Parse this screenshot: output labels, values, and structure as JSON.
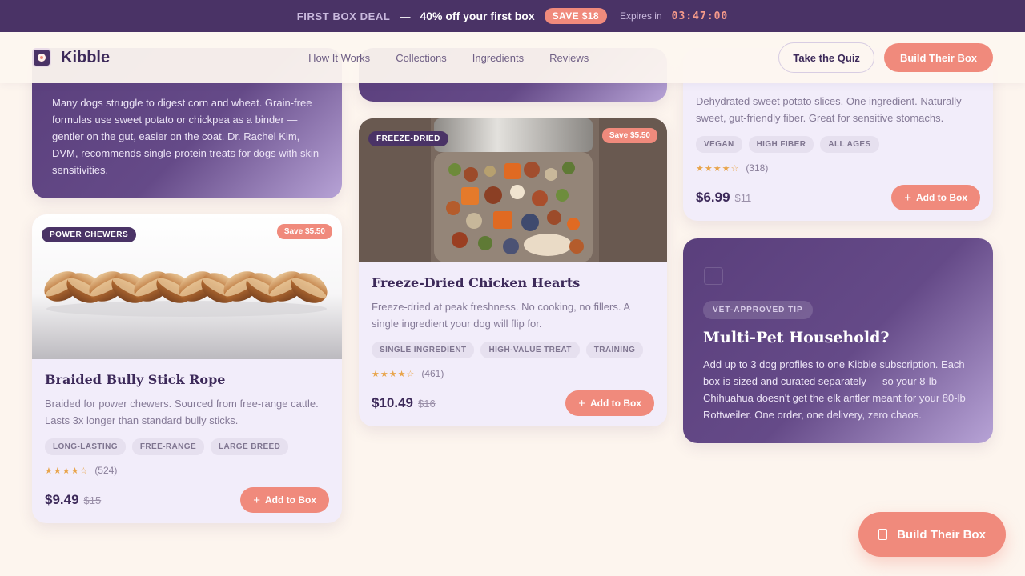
{
  "promo": {
    "deal_label": "FIRST BOX DEAL",
    "separator": "—",
    "offer": "40% off your first box",
    "save_badge": "SAVE $18",
    "expires_label": "Expires in",
    "timer": "03:47:00"
  },
  "header": {
    "logo_text": "Kibble",
    "nav": [
      "How It Works",
      "Collections",
      "Ingredients",
      "Reviews"
    ],
    "quiz_button": "Take the Quiz",
    "build_button": "Build Their Box"
  },
  "tip_card_top": {
    "text": "Many dogs struggle to digest corn and wheat. Grain-free formulas use sweet potato or chickpea as a binder — gentler on the gut, easier on the coat. Dr. Rachel Kim, DVM, recommends single-protein treats for dogs with skin sensitivities."
  },
  "products": [
    {
      "badge": "POWER CHEWERS",
      "save": "Save $5.50",
      "title": "Braided Bully Stick Rope",
      "desc": "Braided for power chewers. Sourced from free-range cattle. Lasts 3x longer than standard bully sticks.",
      "tags": [
        "LONG-LASTING",
        "FREE-RANGE",
        "LARGE BREED"
      ],
      "stars": "★★★★☆",
      "rating": 4,
      "reviews": "(524)",
      "price": "$9.49",
      "old_price": "$15",
      "add_label": "Add to Box"
    },
    {
      "badge": "FREEZE-DRIED",
      "save": "Save $5.50",
      "title": "Freeze-Dried Chicken Hearts",
      "desc": "Freeze-dried at peak freshness. No cooking, no fillers. A single ingredient your dog will flip for.",
      "tags": [
        "SINGLE INGREDIENT",
        "HIGH-VALUE TREAT",
        "TRAINING"
      ],
      "stars": "★★★★☆",
      "rating": 4,
      "reviews": "(461)",
      "price": "$10.49",
      "old_price": "$16",
      "add_label": "Add to Box"
    },
    {
      "desc": "Dehydrated sweet potato slices. One ingredient. Naturally sweet, gut-friendly fiber. Great for sensitive stomachs.",
      "tags": [
        "VEGAN",
        "HIGH FIBER",
        "ALL AGES"
      ],
      "stars": "★★★★☆",
      "rating": 4,
      "reviews": "(318)",
      "price": "$6.99",
      "old_price": "$11",
      "add_label": "Add to Box"
    }
  ],
  "tip_card_right": {
    "badge": "VET-APPROVED TIP",
    "title": "Multi-Pet Household?",
    "text": "Add up to 3 dog profiles to one Kibble subscription. Each box is sized and curated separately — so your 8-lb Chihuahua doesn't get the elk antler meant for your 80-lb Rottweiler. One order, one delivery, zero chaos."
  },
  "fab": {
    "label": "Build Their Box",
    "icon": "box-icon"
  },
  "colors": {
    "primary": "#4a3366",
    "accent": "#f08a7c",
    "background": "#fdf5ee"
  }
}
